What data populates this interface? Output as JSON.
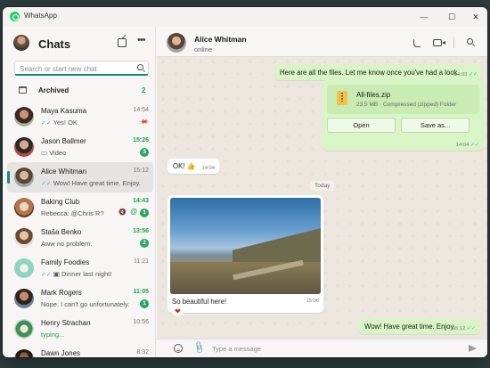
{
  "app": {
    "name": "WhatsApp",
    "minimize": "—",
    "maximize": "☐",
    "close": "✕"
  },
  "sidebar": {
    "title": "Chats",
    "search_placeholder": "Search or start new chat",
    "archived": {
      "label": "Archived",
      "count": "2"
    },
    "chats": [
      {
        "name": "Maya Kasuma",
        "time": "14:54",
        "preview": "Yes! OK",
        "pinned": true
      },
      {
        "name": "Jason Ballmer",
        "time": "15:26",
        "preview": "Video",
        "badge": "3"
      },
      {
        "name": "Alice Whitman",
        "time": "15:12",
        "preview": "Wow! Have great time. Enjoy."
      },
      {
        "name": "Baking Club",
        "time": "14:43",
        "preview": "Rebecca: @Chris R?",
        "badge": "1"
      },
      {
        "name": "Staša Benko",
        "time": "13:56",
        "preview": "Aww no problem.",
        "badge": "2"
      },
      {
        "name": "Family Foodies",
        "time": "11:21",
        "preview": "Dinner last night!"
      },
      {
        "name": "Mark Rogers",
        "time": "11:05",
        "preview": "Nope. I can't go unfortunately.",
        "badge": "1"
      },
      {
        "name": "Henry Strachan",
        "time": "10:56",
        "preview": "typing..."
      },
      {
        "name": "Dawn Jones",
        "time": "8:32",
        "preview": ""
      }
    ]
  },
  "conversation": {
    "contact_name": "Alice Whitman",
    "contact_status": "online",
    "messages": {
      "m1": {
        "text": "Here are all the files. Let me know once you've had a look.",
        "time": "14:03"
      },
      "file": {
        "name": "All-files.zip",
        "info": "23.5 MB · Compressed (zipped) Folder",
        "open_label": "Open",
        "save_label": "Save as...",
        "time": "14:04"
      },
      "ok": {
        "text": "OK! 👍",
        "time": "14:04"
      },
      "day": "Today",
      "photo": {
        "caption": "So beautiful here!",
        "time": "15:06",
        "reaction": "❤"
      },
      "last": {
        "text": "Wow! Have great time. Enjoy.",
        "time": "15:12"
      }
    },
    "composer_placeholder": "Type a message"
  },
  "colors": {
    "accent": "#128c7e",
    "unread": "#25a85e",
    "outgoing_bubble": "#d8f5c6"
  }
}
